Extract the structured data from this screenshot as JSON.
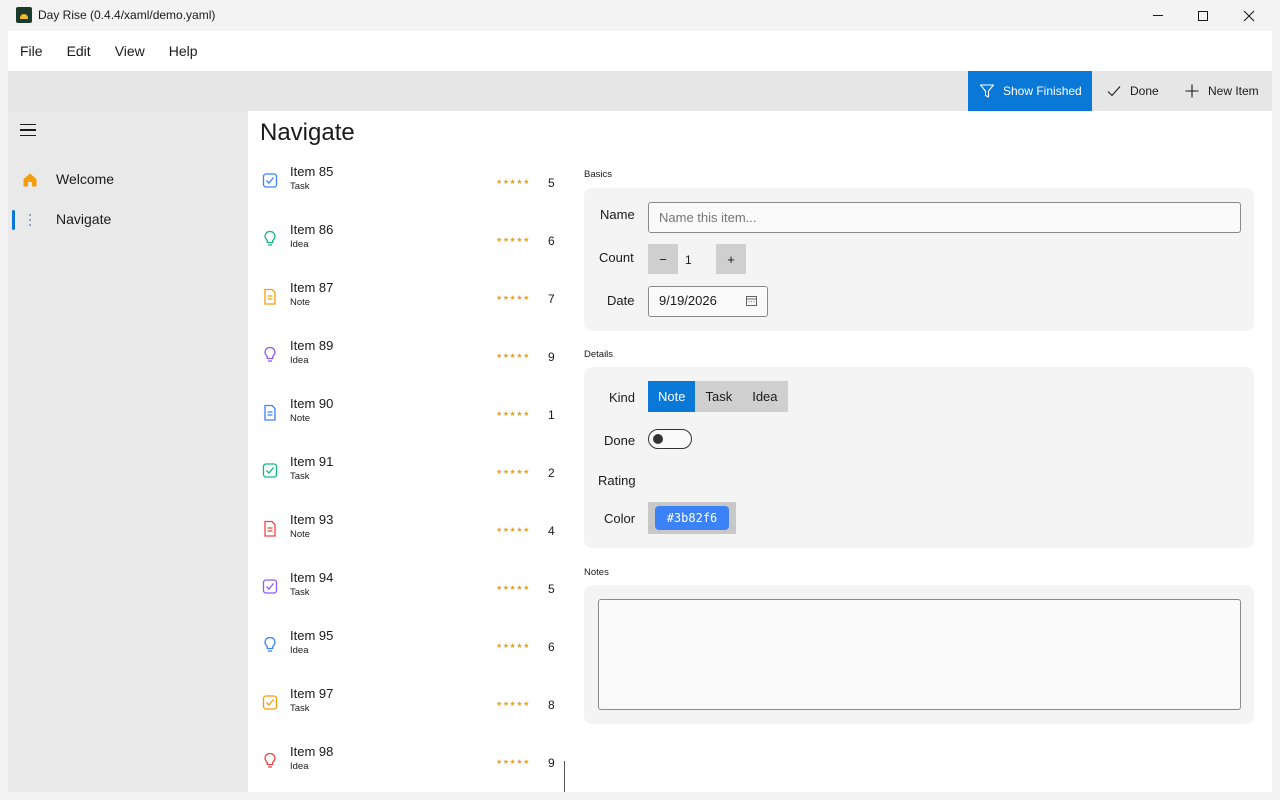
{
  "window": {
    "title": "Day Rise (0.4.4/xaml/demo.yaml)"
  },
  "menu": [
    "File",
    "Edit",
    "View",
    "Help"
  ],
  "toolbar": {
    "show_finished": "Show Finished",
    "done": "Done",
    "new_item": "New Item",
    "accent": "#0a78d6"
  },
  "nav": {
    "items": [
      {
        "label": "Welcome",
        "icon": "home-icon"
      },
      {
        "label": "Navigate",
        "icon": "more-vertical-icon"
      }
    ]
  },
  "page": {
    "title": "Navigate"
  },
  "list": [
    {
      "title": "Item 85",
      "kind": "Task",
      "icon": "check-square-icon",
      "color": "#3b82f6",
      "stars": "★★★★★",
      "rating": "5"
    },
    {
      "title": "Item 86",
      "kind": "Idea",
      "icon": "lightbulb-icon",
      "color": "#10b981",
      "stars": "★★★★★",
      "rating": "6"
    },
    {
      "title": "Item 87",
      "kind": "Note",
      "icon": "note-icon",
      "color": "#f59e0b",
      "stars": "★★★★★",
      "rating": "7"
    },
    {
      "title": "Item 89",
      "kind": "Idea",
      "icon": "lightbulb-icon",
      "color": "#8b5cf6",
      "stars": "★★★★★",
      "rating": "9"
    },
    {
      "title": "Item 90",
      "kind": "Note",
      "icon": "note-icon",
      "color": "#3b82f6",
      "stars": "★★★★★",
      "rating": "1"
    },
    {
      "title": "Item 91",
      "kind": "Task",
      "icon": "check-square-icon",
      "color": "#10b981",
      "stars": "★★★★★",
      "rating": "2"
    },
    {
      "title": "Item 93",
      "kind": "Note",
      "icon": "note-icon",
      "color": "#ef4444",
      "stars": "★★★★★",
      "rating": "4"
    },
    {
      "title": "Item 94",
      "kind": "Task",
      "icon": "check-square-icon",
      "color": "#8b5cf6",
      "stars": "★★★★★",
      "rating": "5"
    },
    {
      "title": "Item 95",
      "kind": "Idea",
      "icon": "lightbulb-icon",
      "color": "#3b82f6",
      "stars": "★★★★★",
      "rating": "6"
    },
    {
      "title": "Item 97",
      "kind": "Task",
      "icon": "check-square-icon",
      "color": "#f59e0b",
      "stars": "★★★★★",
      "rating": "8"
    },
    {
      "title": "Item 98",
      "kind": "Idea",
      "icon": "lightbulb-icon",
      "color": "#ef4444",
      "stars": "★★★★★",
      "rating": "9"
    }
  ],
  "form": {
    "basics_label": "Basics",
    "name_label": "Name",
    "name_placeholder": "Name this item...",
    "count_label": "Count",
    "count_minus": "−",
    "count_value": "1",
    "count_plus": "+",
    "date_label": "Date",
    "date_value": "9/19/2026",
    "details_label": "Details",
    "kind_label": "Kind",
    "kind_options": [
      "Note",
      "Task",
      "Idea"
    ],
    "kind_selected": "Note",
    "done_label": "Done",
    "done_value": false,
    "rating_label": "Rating",
    "color_label": "Color",
    "color_value": "#3b82f6",
    "notes_label": "Notes",
    "notes_value": ""
  }
}
